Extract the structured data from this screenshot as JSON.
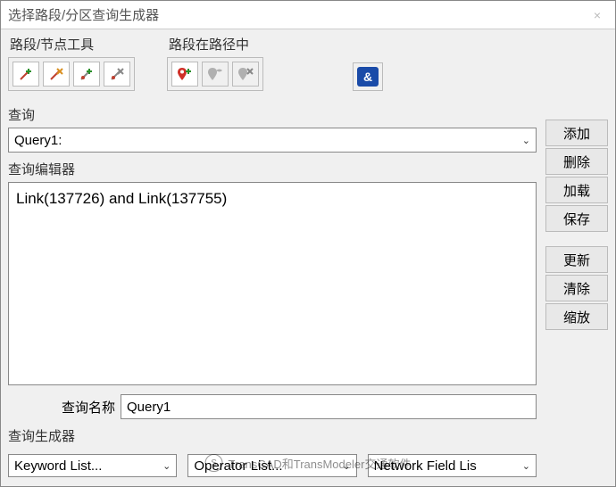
{
  "window": {
    "title": "选择路段/分区查询生成器",
    "close": "×"
  },
  "toolbars": {
    "links_group_label": "路段/节点工具",
    "path_group_label": "路段在路径中",
    "amp_glyph": "&"
  },
  "labels": {
    "query": "查询",
    "editor": "查询编辑器",
    "query_name": "查询名称",
    "generator": "查询生成器"
  },
  "query": {
    "selected": "Query1:",
    "editor_text": "Link(137726) and Link(137755)",
    "name_value": "Query1"
  },
  "buttons": {
    "add": "添加",
    "delete": "删除",
    "load": "加载",
    "save": "保存",
    "refresh": "更新",
    "clear": "清除",
    "zoom": "缩放"
  },
  "builder": {
    "keyword": "Keyword List...",
    "operator": "Operator List...",
    "field": "Network Field Lis"
  },
  "chevron": "⌄",
  "watermark": {
    "icon": "S",
    "text": "TransCAD和TransModeler交通软件"
  }
}
